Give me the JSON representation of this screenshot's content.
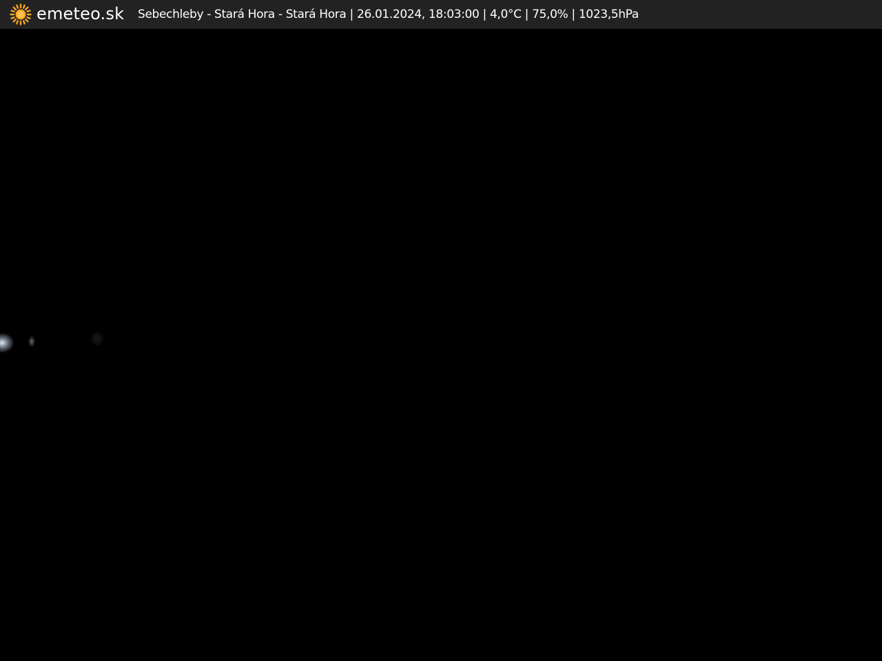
{
  "header": {
    "brand": "emeteo.sk",
    "brand_icon": "sun-icon",
    "caption": "Sebechleby - Stará Hora - Stará Hora | 26.01.2024, 18:03:00 | 4,0°C | 75,0% | 1023,5hPa"
  },
  "colors": {
    "bar_background": "#222222",
    "sun": "#f5a623",
    "text": "#ffffff",
    "feed": "#000000"
  }
}
